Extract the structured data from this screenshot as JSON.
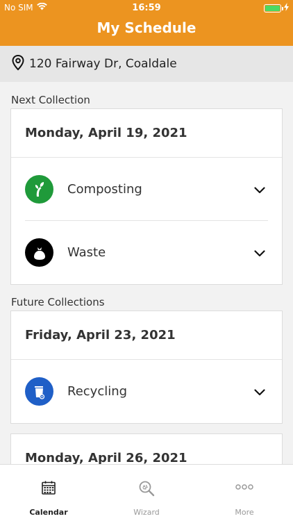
{
  "status_bar": {
    "carrier": "No SIM",
    "time": "16:59"
  },
  "header": {
    "title": "My Schedule"
  },
  "address": {
    "text": "120 Fairway Dr, Coaldale"
  },
  "sections": {
    "next": {
      "label": "Next Collection"
    },
    "future": {
      "label": "Future Collections"
    }
  },
  "cards": [
    {
      "date": "Monday, April 19, 2021",
      "items": [
        {
          "label": "Composting",
          "icon": "compost-icon",
          "color": "#1f9a3a"
        },
        {
          "label": "Waste",
          "icon": "waste-bag-icon",
          "color": "#000000"
        }
      ]
    },
    {
      "date": "Friday, April 23, 2021",
      "items": [
        {
          "label": "Recycling",
          "icon": "recycling-bin-icon",
          "color": "#1f5fc7"
        }
      ]
    },
    {
      "date": "Monday, April 26, 2021",
      "items": []
    }
  ],
  "tabs": [
    {
      "label": "Calendar",
      "icon": "calendar-icon",
      "active": true
    },
    {
      "label": "Wizard",
      "icon": "wizard-search-icon",
      "active": false
    },
    {
      "label": "More",
      "icon": "more-icon",
      "active": false
    }
  ],
  "colors": {
    "accent": "#ec9420",
    "battery": "#4cd964"
  }
}
